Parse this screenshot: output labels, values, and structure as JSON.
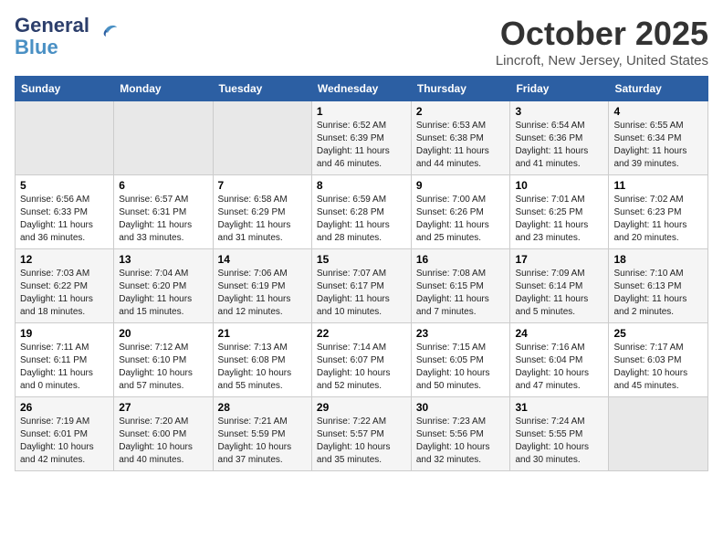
{
  "logo": {
    "line1": "General",
    "line2": "Blue"
  },
  "title": "October 2025",
  "subtitle": "Lincroft, New Jersey, United States",
  "days_of_week": [
    "Sunday",
    "Monday",
    "Tuesday",
    "Wednesday",
    "Thursday",
    "Friday",
    "Saturday"
  ],
  "weeks": [
    [
      {
        "day": "",
        "info": ""
      },
      {
        "day": "",
        "info": ""
      },
      {
        "day": "",
        "info": ""
      },
      {
        "day": "1",
        "info": "Sunrise: 6:52 AM\nSunset: 6:39 PM\nDaylight: 11 hours\nand 46 minutes."
      },
      {
        "day": "2",
        "info": "Sunrise: 6:53 AM\nSunset: 6:38 PM\nDaylight: 11 hours\nand 44 minutes."
      },
      {
        "day": "3",
        "info": "Sunrise: 6:54 AM\nSunset: 6:36 PM\nDaylight: 11 hours\nand 41 minutes."
      },
      {
        "day": "4",
        "info": "Sunrise: 6:55 AM\nSunset: 6:34 PM\nDaylight: 11 hours\nand 39 minutes."
      }
    ],
    [
      {
        "day": "5",
        "info": "Sunrise: 6:56 AM\nSunset: 6:33 PM\nDaylight: 11 hours\nand 36 minutes."
      },
      {
        "day": "6",
        "info": "Sunrise: 6:57 AM\nSunset: 6:31 PM\nDaylight: 11 hours\nand 33 minutes."
      },
      {
        "day": "7",
        "info": "Sunrise: 6:58 AM\nSunset: 6:29 PM\nDaylight: 11 hours\nand 31 minutes."
      },
      {
        "day": "8",
        "info": "Sunrise: 6:59 AM\nSunset: 6:28 PM\nDaylight: 11 hours\nand 28 minutes."
      },
      {
        "day": "9",
        "info": "Sunrise: 7:00 AM\nSunset: 6:26 PM\nDaylight: 11 hours\nand 25 minutes."
      },
      {
        "day": "10",
        "info": "Sunrise: 7:01 AM\nSunset: 6:25 PM\nDaylight: 11 hours\nand 23 minutes."
      },
      {
        "day": "11",
        "info": "Sunrise: 7:02 AM\nSunset: 6:23 PM\nDaylight: 11 hours\nand 20 minutes."
      }
    ],
    [
      {
        "day": "12",
        "info": "Sunrise: 7:03 AM\nSunset: 6:22 PM\nDaylight: 11 hours\nand 18 minutes."
      },
      {
        "day": "13",
        "info": "Sunrise: 7:04 AM\nSunset: 6:20 PM\nDaylight: 11 hours\nand 15 minutes."
      },
      {
        "day": "14",
        "info": "Sunrise: 7:06 AM\nSunset: 6:19 PM\nDaylight: 11 hours\nand 12 minutes."
      },
      {
        "day": "15",
        "info": "Sunrise: 7:07 AM\nSunset: 6:17 PM\nDaylight: 11 hours\nand 10 minutes."
      },
      {
        "day": "16",
        "info": "Sunrise: 7:08 AM\nSunset: 6:15 PM\nDaylight: 11 hours\nand 7 minutes."
      },
      {
        "day": "17",
        "info": "Sunrise: 7:09 AM\nSunset: 6:14 PM\nDaylight: 11 hours\nand 5 minutes."
      },
      {
        "day": "18",
        "info": "Sunrise: 7:10 AM\nSunset: 6:13 PM\nDaylight: 11 hours\nand 2 minutes."
      }
    ],
    [
      {
        "day": "19",
        "info": "Sunrise: 7:11 AM\nSunset: 6:11 PM\nDaylight: 11 hours\nand 0 minutes."
      },
      {
        "day": "20",
        "info": "Sunrise: 7:12 AM\nSunset: 6:10 PM\nDaylight: 10 hours\nand 57 minutes."
      },
      {
        "day": "21",
        "info": "Sunrise: 7:13 AM\nSunset: 6:08 PM\nDaylight: 10 hours\nand 55 minutes."
      },
      {
        "day": "22",
        "info": "Sunrise: 7:14 AM\nSunset: 6:07 PM\nDaylight: 10 hours\nand 52 minutes."
      },
      {
        "day": "23",
        "info": "Sunrise: 7:15 AM\nSunset: 6:05 PM\nDaylight: 10 hours\nand 50 minutes."
      },
      {
        "day": "24",
        "info": "Sunrise: 7:16 AM\nSunset: 6:04 PM\nDaylight: 10 hours\nand 47 minutes."
      },
      {
        "day": "25",
        "info": "Sunrise: 7:17 AM\nSunset: 6:03 PM\nDaylight: 10 hours\nand 45 minutes."
      }
    ],
    [
      {
        "day": "26",
        "info": "Sunrise: 7:19 AM\nSunset: 6:01 PM\nDaylight: 10 hours\nand 42 minutes."
      },
      {
        "day": "27",
        "info": "Sunrise: 7:20 AM\nSunset: 6:00 PM\nDaylight: 10 hours\nand 40 minutes."
      },
      {
        "day": "28",
        "info": "Sunrise: 7:21 AM\nSunset: 5:59 PM\nDaylight: 10 hours\nand 37 minutes."
      },
      {
        "day": "29",
        "info": "Sunrise: 7:22 AM\nSunset: 5:57 PM\nDaylight: 10 hours\nand 35 minutes."
      },
      {
        "day": "30",
        "info": "Sunrise: 7:23 AM\nSunset: 5:56 PM\nDaylight: 10 hours\nand 32 minutes."
      },
      {
        "day": "31",
        "info": "Sunrise: 7:24 AM\nSunset: 5:55 PM\nDaylight: 10 hours\nand 30 minutes."
      },
      {
        "day": "",
        "info": ""
      }
    ]
  ]
}
